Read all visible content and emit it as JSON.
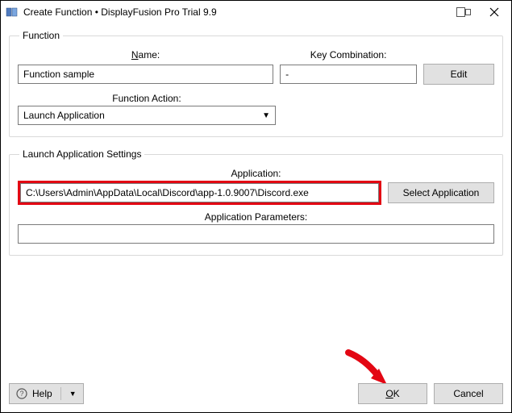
{
  "window": {
    "title": "Create Function • DisplayFusion Pro Trial 9.9"
  },
  "groups": {
    "function": {
      "legend": "Function",
      "name_label_pre": "N",
      "name_label_post": "ame:",
      "name_value": "Function sample",
      "key_label": "Key Combination:",
      "key_value": "-",
      "edit_label": "Edit",
      "action_label": "Function Action:",
      "action_value": "Launch Application"
    },
    "settings": {
      "legend": "Launch Application Settings",
      "app_label": "Application:",
      "app_value": "C:\\Users\\Admin\\AppData\\Local\\Discord\\app-1.0.9007\\Discord.exe",
      "select_app_label": "Select Application",
      "params_label": "Application Parameters:",
      "params_value": ""
    }
  },
  "footer": {
    "help_label": "Help",
    "ok_pre": "O",
    "ok_post": "K",
    "cancel_label": "Cancel"
  }
}
